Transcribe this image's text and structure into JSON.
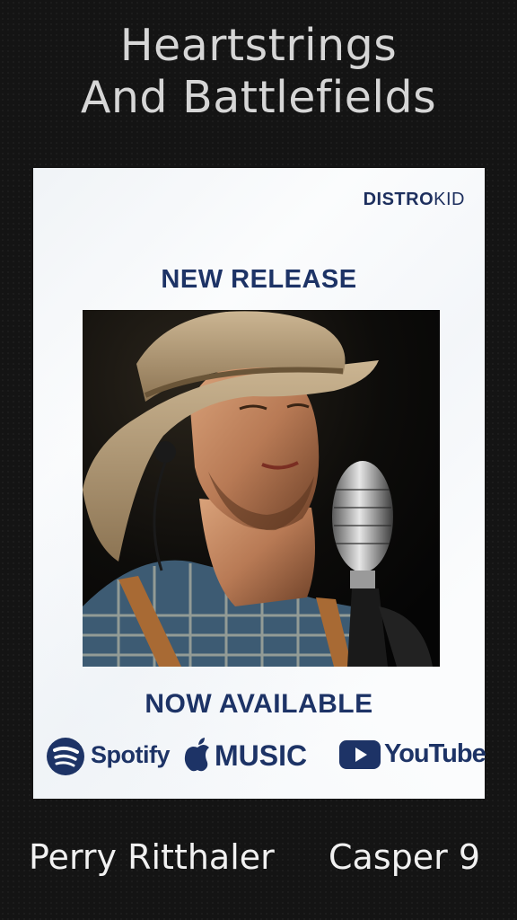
{
  "title": {
    "line1": "Heartstrings",
    "line2": "And Battlefields"
  },
  "poster": {
    "brand_bold": "DISTRO",
    "brand_light": "KID",
    "headline": "NEW RELEASE",
    "subheadline": "NOW AVAILABLE",
    "photo_icon": "singer-with-microphone-photo",
    "platforms": [
      {
        "icon": "spotify-icon",
        "label": "Spotify"
      },
      {
        "icon": "apple-icon",
        "label": "MUSIC"
      },
      {
        "icon": "youtube-icon",
        "label": "YouTube"
      }
    ]
  },
  "footer": {
    "artist": "Perry Ritthaler",
    "catalog": "Casper 9"
  },
  "colors": {
    "background": "#141414",
    "title_text": "#d6d6d6",
    "brand_navy": "#1d3366",
    "poster_bg": "#fbfcfd"
  }
}
